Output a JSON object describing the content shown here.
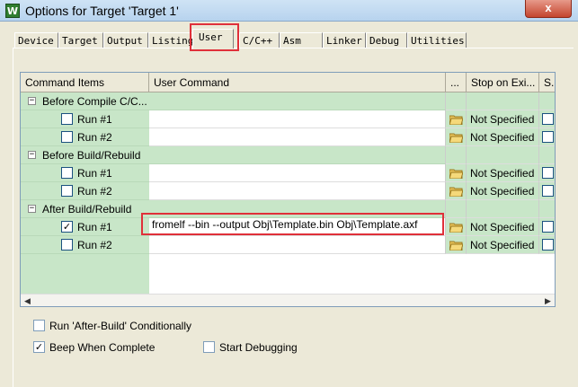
{
  "window": {
    "title": "Options for Target 'Target 1'",
    "icon_letter": "W",
    "close_label": "x"
  },
  "tabs": [
    "Device",
    "Target",
    "Output",
    "Listing",
    "User",
    "C/C++",
    "Asm",
    "Linker",
    "Debug",
    "Utilities"
  ],
  "active_tab": "User",
  "grid": {
    "columns": [
      "Command Items",
      "User Command",
      "...",
      "Stop on Exi...",
      "S."
    ],
    "groups": [
      {
        "label": "Before Compile C/C...",
        "expander": "⊟",
        "runs": [
          {
            "label": "Run #1",
            "checked": false,
            "command": "",
            "stop": "Not Specified"
          },
          {
            "label": "Run #2",
            "checked": false,
            "command": "",
            "stop": "Not Specified"
          }
        ]
      },
      {
        "label": "Before Build/Rebuild",
        "expander": "⊟",
        "runs": [
          {
            "label": "Run #1",
            "checked": false,
            "command": "",
            "stop": "Not Specified"
          },
          {
            "label": "Run #2",
            "checked": false,
            "command": "",
            "stop": "Not Specified"
          }
        ]
      },
      {
        "label": "After Build/Rebuild",
        "expander": "⊟",
        "runs": [
          {
            "label": "Run #1",
            "checked": true,
            "command": "fromelf --bin --output Obj\\Template.bin Obj\\Template.axf",
            "stop": "Not Specified"
          },
          {
            "label": "Run #2",
            "checked": false,
            "command": "",
            "stop": "Not Specified"
          }
        ]
      }
    ]
  },
  "options": {
    "run_after_build": {
      "label": "Run 'After-Build' Conditionally",
      "checked": false
    },
    "beep": {
      "label": "Beep When Complete",
      "checked": true
    },
    "start_debugging": {
      "label": "Start Debugging",
      "checked": false
    }
  },
  "colors": {
    "accent_highlight": "#e0303a",
    "tree_bg": "#c8e6c8"
  }
}
